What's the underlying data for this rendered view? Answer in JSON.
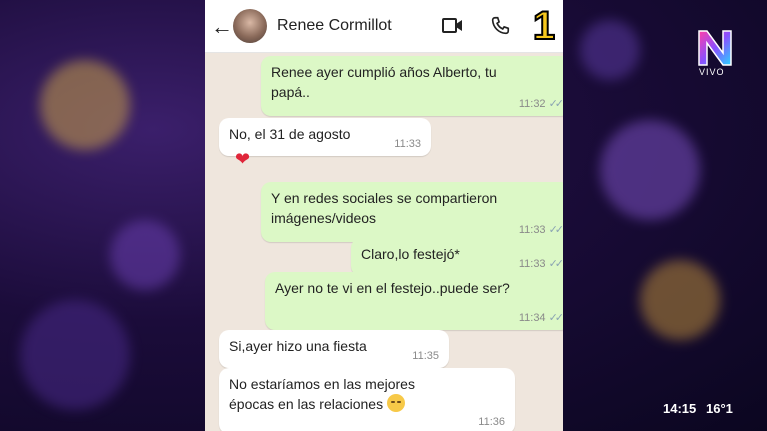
{
  "header": {
    "contact_name": "Renee Cormillot",
    "episode_number": "1"
  },
  "messages": [
    {
      "direction": "out",
      "lines": [
        "Renee ayer cumplió años Alberto, tu",
        "papá.."
      ],
      "time": "11:32",
      "ticks": "✓✓"
    },
    {
      "direction": "in",
      "lines": [
        "No, el 31 de agosto"
      ],
      "time": "11:33"
    },
    {
      "direction": "out",
      "lines": [
        "Y en redes sociales se compartieron",
        "imágenes/videos"
      ],
      "time": "11:33",
      "ticks": "✓✓"
    },
    {
      "direction": "out",
      "lines": [
        "Claro,lo festejó*"
      ],
      "time": "11:33",
      "ticks": "✓✓"
    },
    {
      "direction": "out",
      "lines": [
        "Ayer no te vi en el festejo..puede ser?"
      ],
      "time": "11:34",
      "ticks": "✓✓"
    },
    {
      "direction": "in",
      "lines": [
        "Si,ayer hizo una fiesta"
      ],
      "time": "11:35"
    },
    {
      "direction": "in",
      "lines": [
        "No estaríamos en las mejores",
        "épocas en las relaciones"
      ],
      "time": "11:36"
    }
  ],
  "reaction": "❤",
  "channel": {
    "logo_letter": "N",
    "live_label": "VIVO"
  },
  "ticker": {
    "time": "14:15",
    "temperature": "16°1"
  },
  "icons": [
    "back-arrow-icon",
    "video-call-icon",
    "phone-icon",
    "heart-icon",
    "sad-face-emoji-icon"
  ]
}
